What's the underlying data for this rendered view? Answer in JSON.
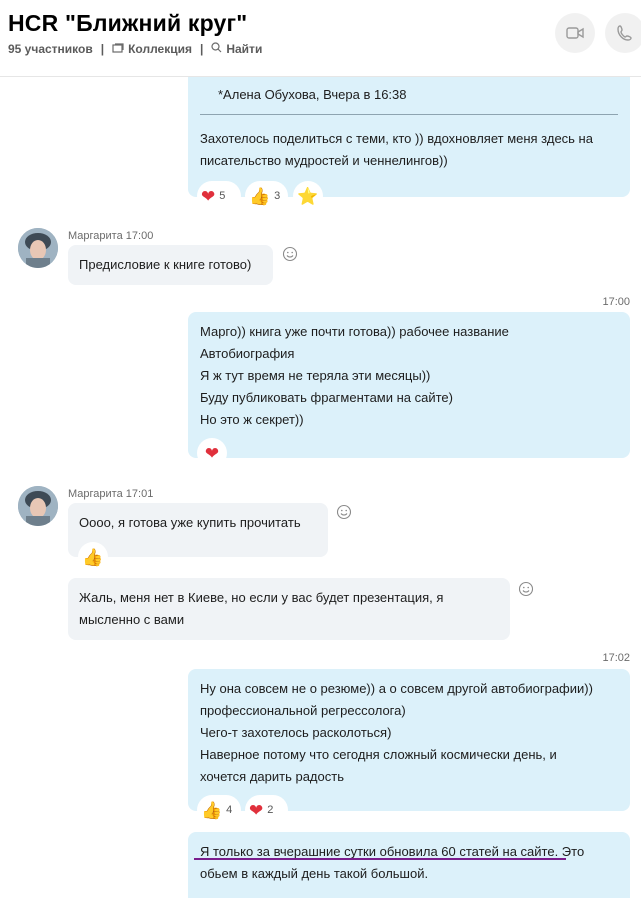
{
  "header": {
    "title": "HCR \"Ближний круг\"",
    "participants": "95 участников",
    "collection": "Коллекция",
    "find": "Найти"
  },
  "messages": {
    "m1": {
      "quote_author": "*Алена Обухова, Вчера в 16:38",
      "lines": [
        "Захотелось поделиться с теми, кто )) вдохновляет меня здесь на",
        "писательство мудростей и ченнелингов))"
      ],
      "reactions": [
        {
          "emoji": "heart-icon",
          "count": "5"
        },
        {
          "emoji": "thumbs-up-icon",
          "count": "3"
        },
        {
          "emoji": "star-icon",
          "count": ""
        }
      ]
    },
    "m2": {
      "sender": "Маргарита",
      "time": "17:00",
      "lines": [
        "Предисловие к книге готово)"
      ]
    },
    "m3": {
      "time": "17:00",
      "lines": [
        "Марго)) книга уже почти готова)) рабочее название",
        "Автобиография",
        "Я ж тут время не теряла эти месяцы))",
        "Буду публиковать фрагментами на сайте)",
        "Но это ж секрет))"
      ]
    },
    "m4": {
      "sender": "Маргарита",
      "time": "17:01",
      "lines": [
        "Оооо, я готова уже купить  прочитать"
      ]
    },
    "m5": {
      "lines": [
        "Жаль, меня нет в Киеве, но если у вас будет презентация, я",
        "мысленно с вами"
      ]
    },
    "m6": {
      "time": "17:02",
      "lines": [
        "Ну она совсем не о резюме)) а о совсем другой автобиографии))",
        "профессиональной регрессолога)",
        "Чего-т захотелось расколоться)",
        "Наверное потому что сегодня сложный космически день, и",
        "хочется дарить радость"
      ],
      "reactions": [
        {
          "emoji": "thumbs-up-icon",
          "count": "4"
        },
        {
          "emoji": "heart-icon",
          "count": "2"
        }
      ]
    },
    "m7": {
      "lines": [
        "Я только за вчерашние сутки обновила 60 статей на сайте. Это",
        "обьем в каждый день такой большой."
      ]
    }
  },
  "colors": {
    "outgoing_bubble": "#dcf1fa",
    "incoming_bubble": "#f0f3f6",
    "underline": "#7a1d8c"
  }
}
